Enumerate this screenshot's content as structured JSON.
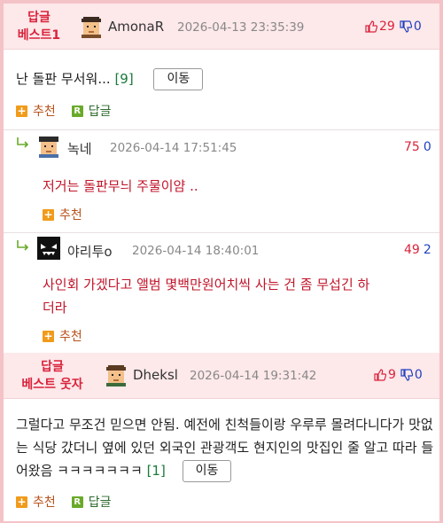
{
  "comments": [
    {
      "badge": "답글\n베스트1",
      "badge_line1": "답글",
      "badge_line2": "베스트1",
      "author": "AmonaR",
      "datetime": "2026-04-13 23:35:39",
      "up": "29",
      "down": "0",
      "text": "난 돌판 무서워...",
      "reply_count": "[9]",
      "move_label": "이동",
      "recommend_label": "추천",
      "reply_label": "답글"
    },
    {
      "badge_line1": "답글",
      "badge_line2": "베스트 웃자",
      "author": "Dheksl",
      "datetime": "2026-04-14 19:31:42",
      "up": "9",
      "down": "0",
      "text": "그럴다고 무조건 믿으면 안됨. 예전에 친척들이랑 우루루 몰려다니다가 맛없는 식당 갔더니 옆에 있던 외국인 관광객도 현지인의 맛집인 줄 알고 따라 들어왔음 ㅋㅋㅋㅋㅋㅋㅋ",
      "reply_count": "[1]",
      "move_label": "이동",
      "recommend_label": "추천",
      "reply_label": "답글"
    }
  ],
  "replies": [
    {
      "author": "녹네",
      "datetime": "2026-04-14 17:51:45",
      "up": "75",
      "down": "0",
      "text": "저거는 돌판무늬 주물이얌 ..",
      "recommend_label": "추천"
    },
    {
      "author": "야리투o",
      "datetime": "2026-04-14 18:40:01",
      "up": "49",
      "down": "2",
      "text_line1": "사인회 가겠다고 앨범 몇백만원어치씩 사는 건 좀 무섭긴 하",
      "text_line2": "더라",
      "recommend_label": "추천"
    }
  ],
  "icons": {
    "reply_arrow": "reply-arrow-icon",
    "thumb_up": "thumb-up-icon",
    "thumb_down": "thumb-down-icon",
    "recommend": "plus-icon",
    "reply": "r-icon"
  },
  "colors": {
    "page_border": "#f4c3c7",
    "best_header_bg": "#fde8ea",
    "badge_red": "#d9233b",
    "up_red": "#d9233b",
    "down_blue": "#1f3fbf",
    "reply_text_red": "#c0152a"
  }
}
